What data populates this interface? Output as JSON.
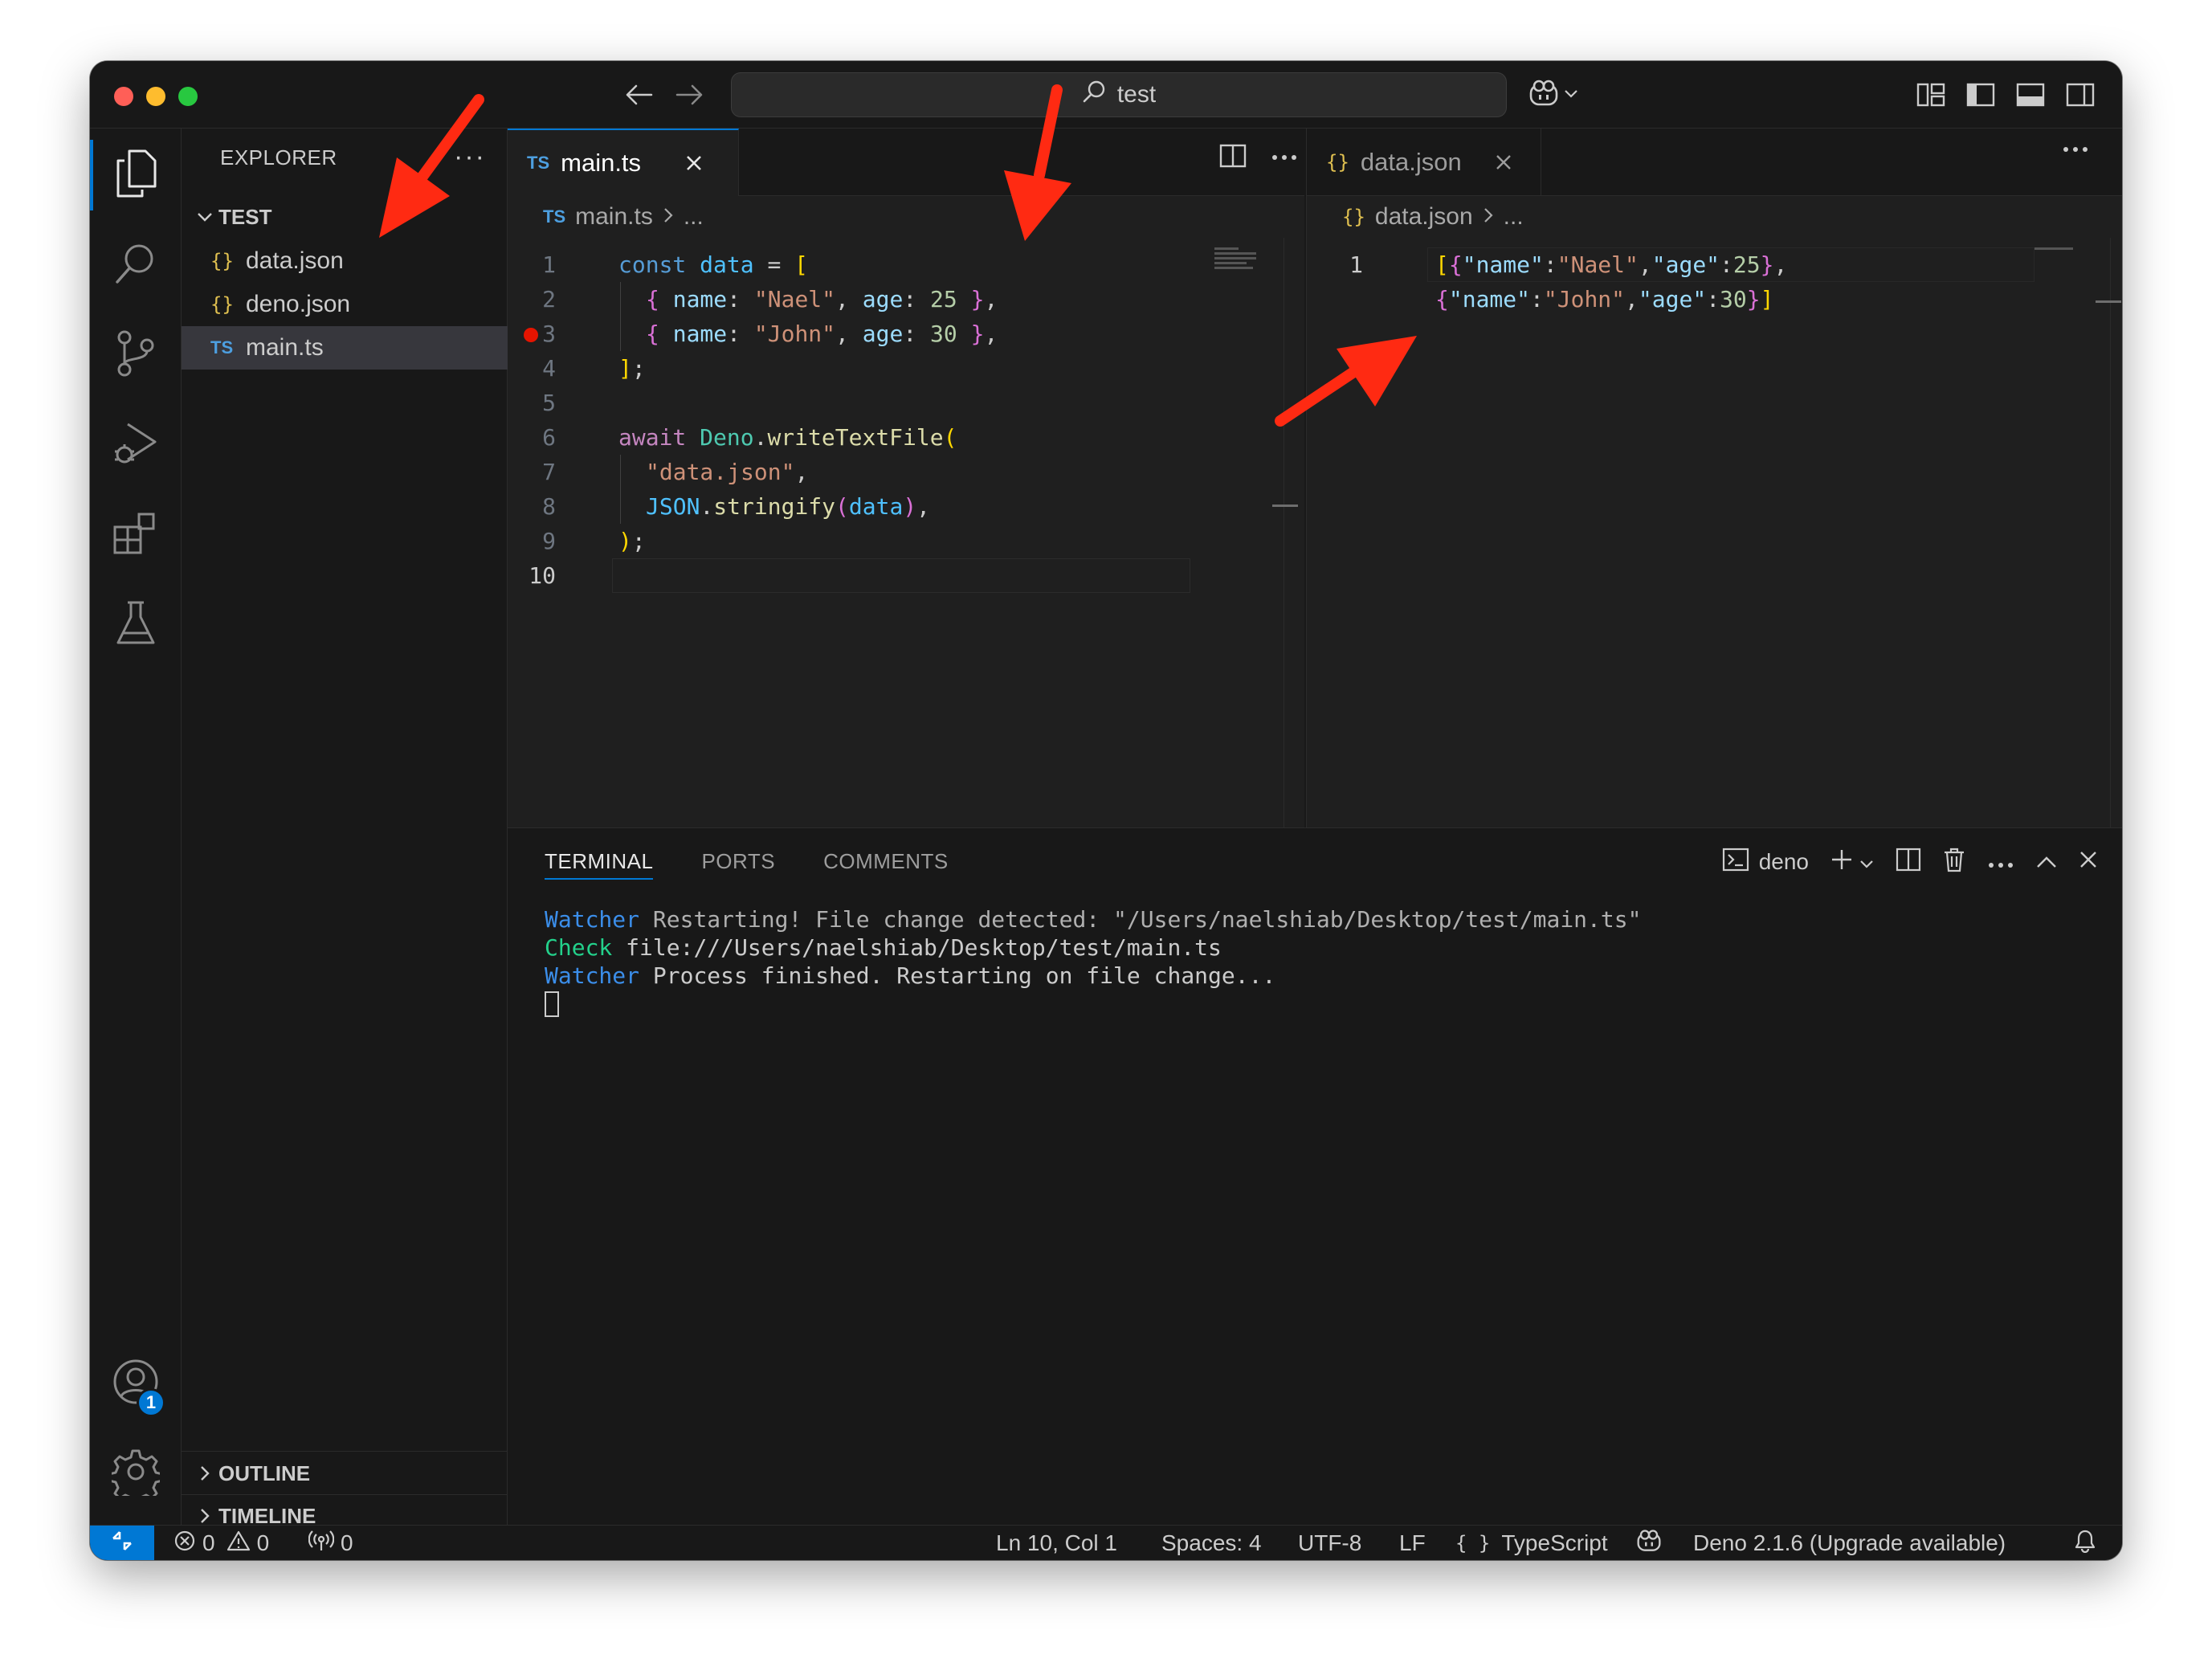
{
  "titlebar": {
    "search_text": "test",
    "icons": [
      "back-arrow-icon",
      "forward-arrow-icon",
      "search-icon",
      "copilot-icon",
      "customize-layout-icon",
      "toggle-sidebar-icon",
      "toggle-panel-icon",
      "toggle-secondary-sidebar-icon"
    ]
  },
  "activity_bar": {
    "items": [
      "explorer",
      "search",
      "source-control",
      "run-and-debug",
      "extensions",
      "testing"
    ],
    "accounts_badge": "1"
  },
  "sidebar": {
    "title": "EXPLORER",
    "more": "···",
    "folder": "TEST",
    "files": [
      {
        "name": "data.json",
        "icon": "{}"
      },
      {
        "name": "deno.json",
        "icon": "{}"
      },
      {
        "name": "main.ts",
        "icon": "TS"
      }
    ],
    "outline": "OUTLINE",
    "timeline": "TIMELINE"
  },
  "editor_left": {
    "tab_label": "main.ts",
    "tab_icon": "TS",
    "breadcrumb_file": "main.ts",
    "breadcrumb_rest": "...",
    "line_numbers": [
      "1",
      "2",
      "3",
      "4",
      "5",
      "6",
      "7",
      "8",
      "9",
      "10"
    ],
    "code": {
      "l1_kw": "const",
      "l1_var": "data",
      "l1_eq": " = ",
      "l1_br": "[",
      "l2_open": "{ ",
      "l2_prop1": "name",
      "l2_c1": ": ",
      "l2_str": "\"Nael\"",
      "l2_comma": ", ",
      "l2_prop2": "age",
      "l2_c2": ": ",
      "l2_num": "25",
      "l2_close": " }",
      "l2_end": ",",
      "l3_open": "{ ",
      "l3_prop1": "name",
      "l3_c1": ": ",
      "l3_str": "\"John\"",
      "l3_comma": ", ",
      "l3_prop2": "age",
      "l3_c2": ": ",
      "l3_num": "30",
      "l3_close": " }",
      "l3_end": ",",
      "l4_br": "]",
      "l4_semi": ";",
      "l6_kw": "await",
      "l6_cls": "Deno",
      "l6_dot": ".",
      "l6_fn": "writeTextFile",
      "l6_paren": "(",
      "l7_str": "\"data.json\"",
      "l7_comma": ",",
      "l8_cls": "JSON",
      "l8_dot": ".",
      "l8_fn": "stringify",
      "l8_po": "(",
      "l8_var": "data",
      "l8_pc": ")",
      "l8_comma": ",",
      "l9_paren": ")",
      "l9_semi": ";"
    }
  },
  "editor_right": {
    "tab_label": "data.json",
    "tab_icon": "{}",
    "breadcrumb_file": "data.json",
    "breadcrumb_rest": "...",
    "line_number": "1",
    "code": {
      "a_open": "[",
      "o1_open": "{",
      "k1": "\"name\"",
      "c1": ":",
      "v1": "\"Nael\"",
      "s1": ",",
      "k2": "\"age\"",
      "c2": ":",
      "n1": "25",
      "o1_close": "}",
      "s2": ",",
      "o2_open": "{",
      "k3": "\"name\"",
      "c3": ":",
      "v2": "\"John\"",
      "s3": ",",
      "k4": "\"age\"",
      "c4": ":",
      "n2": "30",
      "o2_close": "}",
      "a_close": "]"
    }
  },
  "panel": {
    "tabs": [
      "TERMINAL",
      "PORTS",
      "COMMENTS"
    ],
    "active_tab": "TERMINAL",
    "terminal_name": "deno",
    "lines": [
      {
        "label": "Watcher",
        "text": " Restarting! File change detected: \"/Users/naelshiab/Desktop/test/main.ts\""
      },
      {
        "label": "Check",
        "text": " file:///Users/naelshiab/Desktop/test/main.ts"
      },
      {
        "label": "Watcher",
        "text": " Process finished. Restarting on file change..."
      }
    ]
  },
  "statusbar": {
    "errors": "0",
    "warnings": "0",
    "ports": "0",
    "position": "Ln 10, Col 1",
    "spaces": "Spaces: 4",
    "encoding": "UTF-8",
    "eol": "LF",
    "language_icon": "{ }",
    "language": "TypeScript",
    "deno": "Deno 2.1.6 (Upgrade available)"
  },
  "colors": {
    "accent": "#0078d4",
    "annotation_arrow": "#ff2a12",
    "breakpoint": "#e51400",
    "traffic_close": "#ff5f57",
    "traffic_min": "#febc2e",
    "traffic_max": "#28c840"
  }
}
